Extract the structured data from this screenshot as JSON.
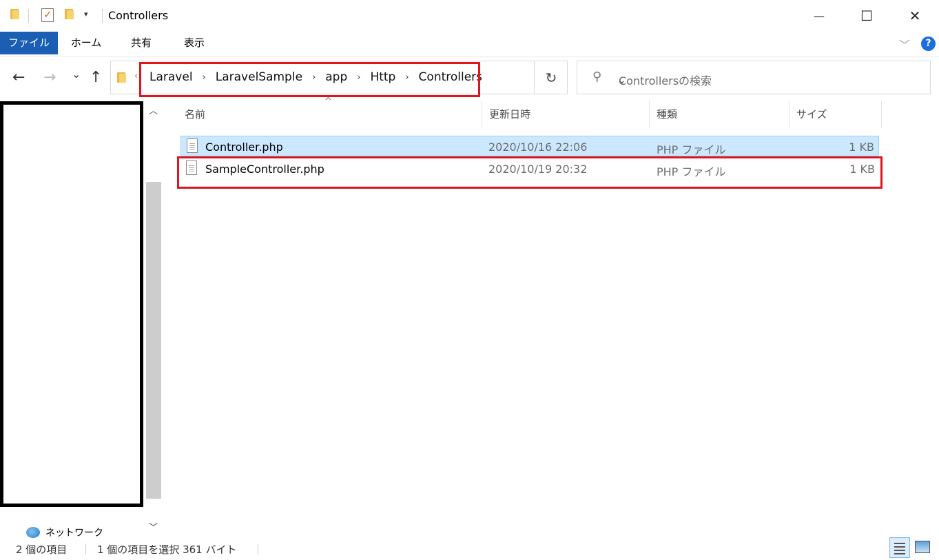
{
  "window": {
    "title": "Controllers",
    "minimize_glyph": "—",
    "maximize_glyph": "☐",
    "close_glyph": "✕"
  },
  "ribbon": {
    "tabs": [
      {
        "label": "ファイル",
        "active": true
      },
      {
        "label": "ホーム"
      },
      {
        "label": "共有"
      },
      {
        "label": "表示"
      }
    ],
    "help_glyph": "?"
  },
  "nav": {
    "back_glyph": "←",
    "forward_glyph": "→",
    "recent_glyph": "⌄",
    "up_glyph": "↑",
    "breadcrumb": [
      "Laravel",
      "LaravelSample",
      "app",
      "Http",
      "Controllers"
    ],
    "refresh_glyph": "↻",
    "search_placeholder": "Controllersの検索"
  },
  "columns": {
    "name": "名前",
    "date": "更新日時",
    "type": "種類",
    "size": "サイズ"
  },
  "files": [
    {
      "name": "Controller.php",
      "date": "2020/10/16 22:06",
      "type": "PHP ファイル",
      "size": "1 KB",
      "selected": true
    },
    {
      "name": "SampleController.php",
      "date": "2020/10/19 20:32",
      "type": "PHP ファイル",
      "size": "1 KB",
      "selected": false
    }
  ],
  "left_pane": {
    "network_label": "ネットワーク"
  },
  "status": {
    "item_count": "2 個の項目",
    "selection": "1 個の項目を選択  361 バイト"
  },
  "colors": {
    "accent": "#1a5fb4",
    "selection_bg": "#cce8ff",
    "highlight_box": "#e0141d"
  }
}
